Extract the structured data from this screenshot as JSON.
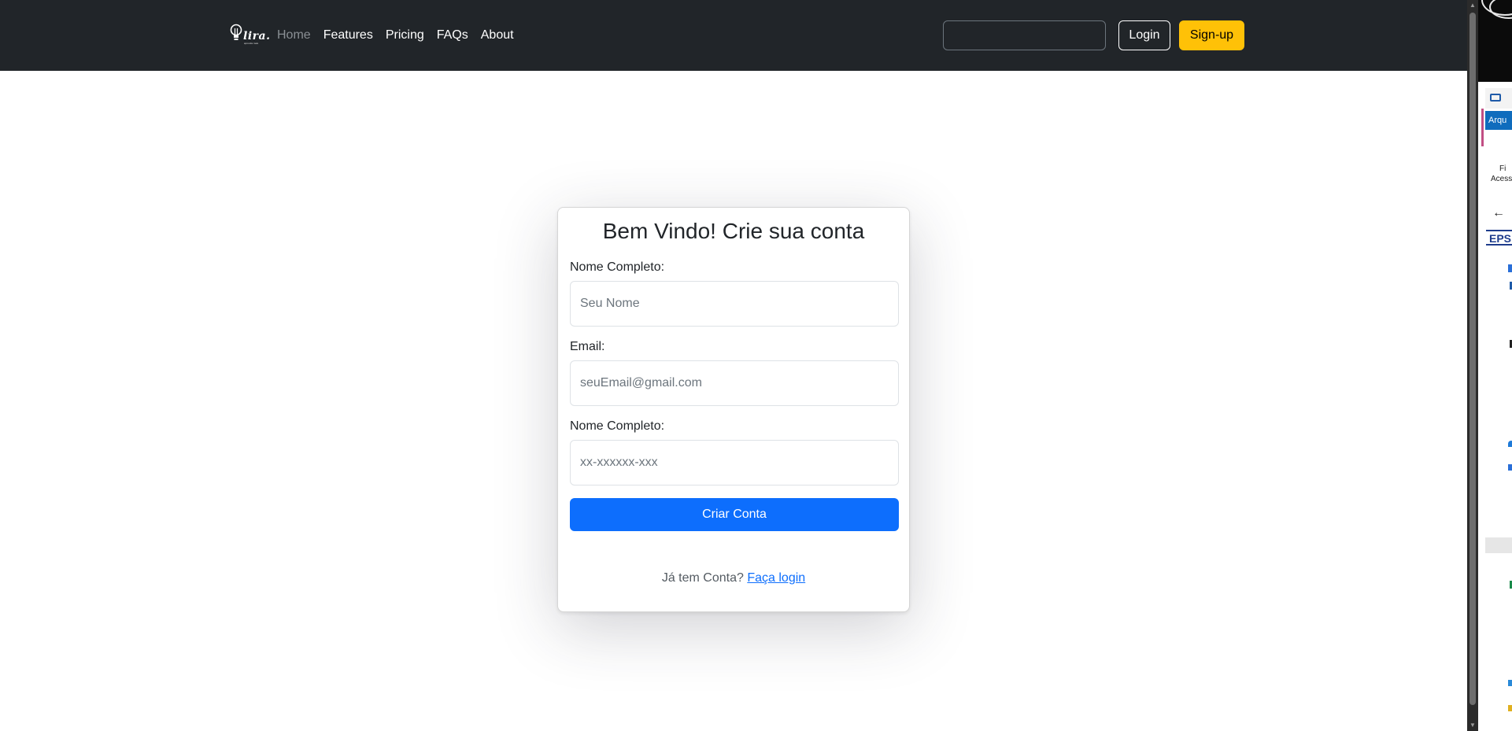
{
  "navbar": {
    "brand": "lira.",
    "tagline": "aprenda mais",
    "links": [
      {
        "label": "Home",
        "active": false
      },
      {
        "label": "Features",
        "active": true
      },
      {
        "label": "Pricing",
        "active": true
      },
      {
        "label": "FAQs",
        "active": true
      },
      {
        "label": "About",
        "active": true
      }
    ],
    "search_value": "",
    "login_label": "Login",
    "signup_label": "Sign-up"
  },
  "form": {
    "title": "Bem Vindo! Crie sua conta",
    "fields": [
      {
        "label": "Nome Completo:",
        "placeholder": "Seu Nome",
        "value": ""
      },
      {
        "label": "Email:",
        "placeholder": "seuEmail@gmail.com",
        "value": ""
      },
      {
        "label": "Nome Completo:",
        "placeholder": "xx-xxxxxx-xxx",
        "value": ""
      }
    ],
    "submit_label": "Criar Conta",
    "footer_text": "Já tem Conta?",
    "footer_link": "Faça login"
  },
  "side_app": {
    "tab_label": "Arqu",
    "ribbon_lines": [
      "Fi",
      "Acess"
    ],
    "brand_label": "EPS"
  },
  "colors": {
    "navbar_bg": "#212529",
    "primary": "#0d6efd",
    "warning": "#ffc107",
    "link": "#0d6efd"
  }
}
